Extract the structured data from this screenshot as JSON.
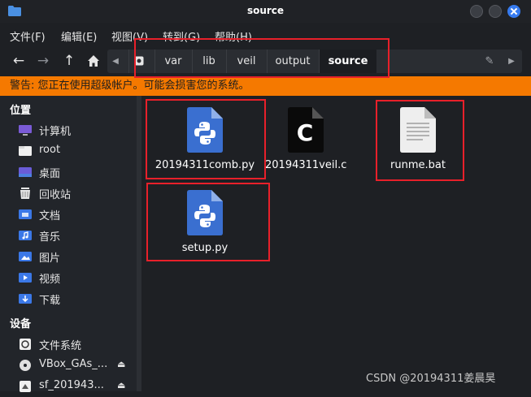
{
  "window": {
    "title": "source"
  },
  "menubar": {
    "items": [
      {
        "label": "文件(F)"
      },
      {
        "label": "编辑(E)"
      },
      {
        "label": "视图(V)"
      },
      {
        "label": "转到(G)"
      },
      {
        "label": "帮助(H)"
      }
    ]
  },
  "pathbar": {
    "crumbs": [
      {
        "label": "var"
      },
      {
        "label": "lib"
      },
      {
        "label": "veil"
      },
      {
        "label": "output"
      },
      {
        "label": "source"
      }
    ]
  },
  "warning": {
    "text": "警告: 您正在使用超级帐户。可能会损害您的系统。"
  },
  "sidebar": {
    "places_heading": "位置",
    "places": [
      {
        "label": "计算机",
        "icon": "computer-icon"
      },
      {
        "label": "root",
        "icon": "home-folder-icon"
      },
      {
        "label": "桌面",
        "icon": "desktop-icon"
      },
      {
        "label": "回收站",
        "icon": "trash-icon"
      },
      {
        "label": "文档",
        "icon": "documents-folder-icon"
      },
      {
        "label": "音乐",
        "icon": "music-folder-icon"
      },
      {
        "label": "图片",
        "icon": "pictures-folder-icon"
      },
      {
        "label": "视频",
        "icon": "videos-folder-icon"
      },
      {
        "label": "下载",
        "icon": "downloads-folder-icon"
      }
    ],
    "devices_heading": "设备",
    "devices": [
      {
        "label": "文件系统",
        "icon": "filesystem-icon"
      },
      {
        "label": "VBox_GAs_...",
        "icon": "optical-disc-icon"
      },
      {
        "label": "sf_201943...",
        "icon": "shared-folder-icon"
      }
    ]
  },
  "files": [
    {
      "name": "20194311comb.py",
      "icon": "python-file-icon"
    },
    {
      "name": "20194311veil.c",
      "icon": "c-file-icon"
    },
    {
      "name": "runme.bat",
      "icon": "text-file-icon"
    },
    {
      "name": "setup.py",
      "icon": "python-file-icon"
    }
  ],
  "watermark": "CSDN @20194311姜晨昊",
  "colors": {
    "warning_bg": "#f57900",
    "highlight": "#e8202a",
    "accent": "#367bf0",
    "python_blue": "#3a6fd0"
  }
}
